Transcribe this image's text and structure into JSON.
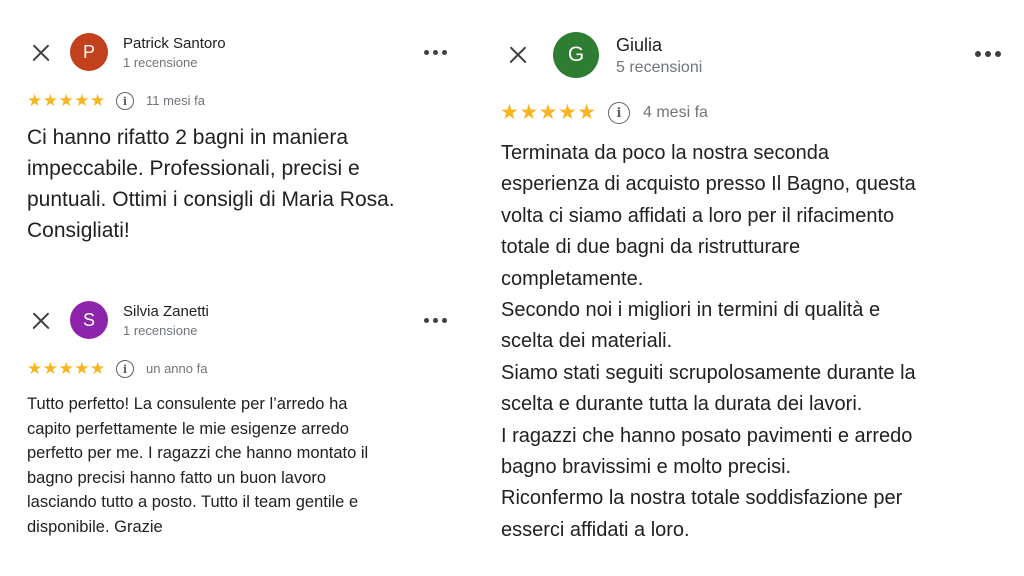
{
  "colors": {
    "star": "#f8b521",
    "avatar_patrick": "#c2411c",
    "avatar_silvia": "#8e24aa",
    "avatar_giulia": "#2e7d32"
  },
  "reviews": [
    {
      "initial": "P",
      "name": "Patrick Santoro",
      "count": "1 recensione",
      "stars": "★★★★★",
      "rating": 5,
      "time": "11 mesi fa",
      "text": "Ci hanno rifatto 2 bagni in maniera\nimpeccabile. Professionali, precisi e\npuntuali. Ottimi i consigli di Maria Rosa.\nConsigliati!"
    },
    {
      "initial": "S",
      "name": "Silvia Zanetti",
      "count": "1 recensione",
      "stars": "★★★★★",
      "rating": 5,
      "time": "un anno fa",
      "text": "Tutto perfetto! La consulente per l’arredo ha\ncapito perfettamente le mie esigenze arredo\nperfetto per me. I ragazzi che hanno montato il\nbagno precisi hanno fatto un buon lavoro\nlasciando tutto a posto. Tutto il team gentile e\ndisponibile. Grazie"
    },
    {
      "initial": "G",
      "name": "Giulia",
      "count": "5 recensioni",
      "stars": "★★★★★",
      "rating": 5,
      "time": "4 mesi fa",
      "text": "Terminata da poco la nostra seconda\nesperienza di acquisto presso Il Bagno, questa\nvolta ci siamo affidati a loro per il rifacimento\ntotale di due bagni da ristrutturare\ncompletamente.\nSecondo noi i migliori in termini di qualità  e\nscelta dei materiali.\nSiamo stati seguiti scrupolosamente durante la\nscelta e durante tutta la durata dei lavori.\nI ragazzi che hanno posato pavimenti e arredo\nbagno bravissimi e molto precisi.\nRiconfermo la nostra totale soddisfazione per\nesserci affidati a loro."
    }
  ]
}
